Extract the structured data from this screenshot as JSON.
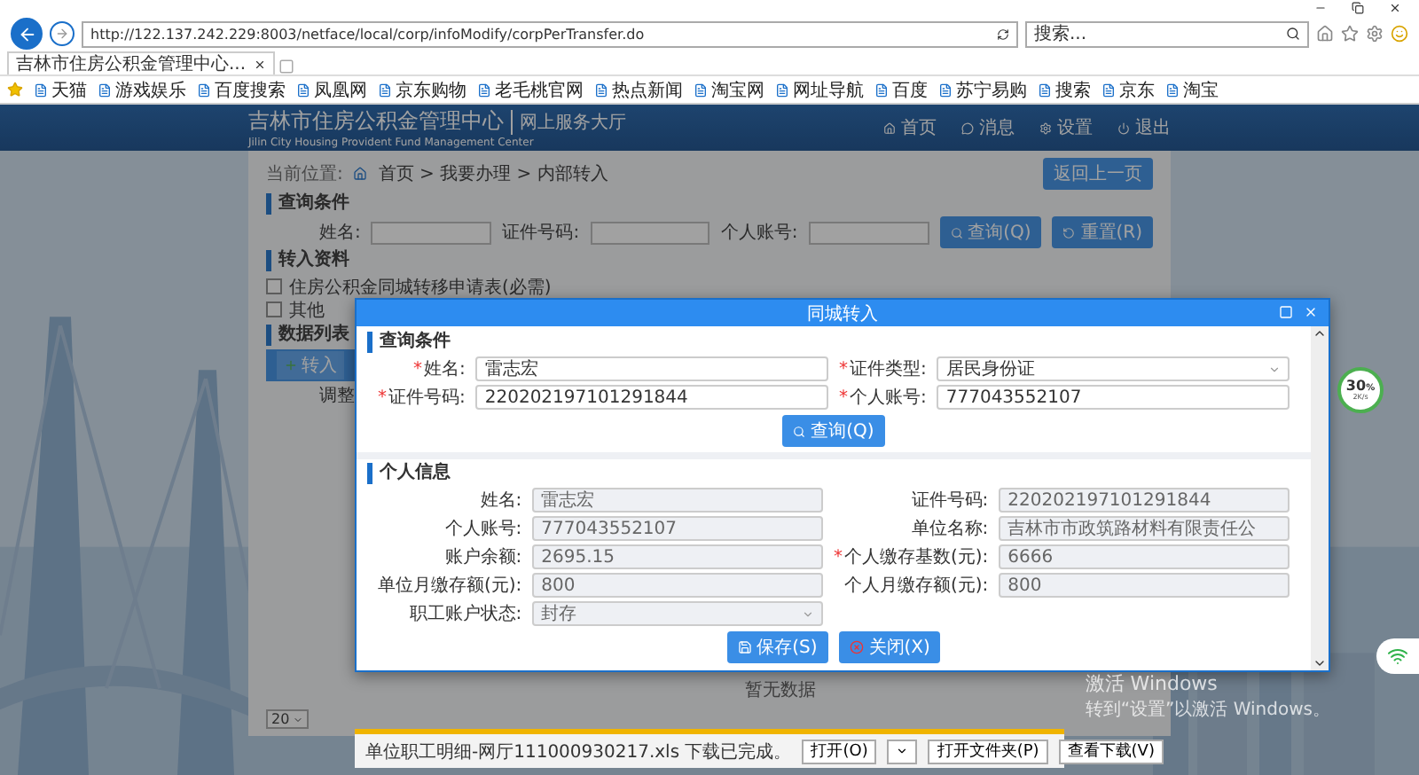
{
  "browser": {
    "url": "http://122.137.242.229:8003/netface/local/corp/infoModify/corpPerTransfer.do",
    "search_placeholder": "搜索...",
    "tab_title": "吉林市住房公积金管理中心...",
    "favorites": [
      "天猫",
      "游戏娱乐",
      "百度搜索",
      "凤凰网",
      "京东购物",
      "老毛桃官网",
      "热点新闻",
      "淘宝网",
      "网址导航",
      "百度",
      "苏宁易购",
      "搜索",
      "京东",
      "淘宝"
    ]
  },
  "header": {
    "title": "吉林市住房公积金管理中心",
    "subtitle": "网上服务大厅",
    "english": "Jilin City Housing Provident Fund Management Center",
    "nav": [
      {
        "label": "首页",
        "kind": "home"
      },
      {
        "label": "消息",
        "kind": "message"
      },
      {
        "label": "设置",
        "kind": "settings"
      },
      {
        "label": "退出",
        "kind": "logout"
      }
    ]
  },
  "breadcrumb": {
    "label": "当前位置:",
    "path": "首页 > 我要办理 > 内部转入"
  },
  "back_button": "返回上一页",
  "query": {
    "title": "查询条件",
    "fields": [
      "姓名:",
      "证件号码:",
      "个人账号:"
    ],
    "buttons": [
      {
        "label": "查询(Q)",
        "kind": "search"
      },
      {
        "label": "重置(R)",
        "kind": "reset"
      }
    ]
  },
  "materials": {
    "title": "转入资料",
    "items": [
      {
        "label": "住房公积金同城转移申请表(必需)",
        "checked": false
      },
      {
        "label": "其他",
        "checked": false
      }
    ]
  },
  "data_list": {
    "title": "数据列表",
    "add_button": "转入",
    "adjust_label": "调整",
    "empty_text": "暂无数据",
    "page_size": "20"
  },
  "modal": {
    "title": "同城转入",
    "query_title": "查询条件",
    "query_fields": [
      {
        "label": "姓名:",
        "value": "雷志宏",
        "marker": "*",
        "kind": "text"
      },
      {
        "label": "证件类型:",
        "value": "居民身份证",
        "marker": "*",
        "kind": "select"
      },
      {
        "label": "证件号码:",
        "value": "220202197101291844",
        "marker": "*",
        "kind": "text"
      },
      {
        "label": "个人账号:",
        "value": "777043552107",
        "marker": "*",
        "kind": "text"
      }
    ],
    "query_button": "查询(Q)",
    "info_title": "个人信息",
    "info_fields": [
      {
        "label": "姓名:",
        "value": "雷志宏",
        "kind": "text"
      },
      {
        "label": "证件号码:",
        "value": "220202197101291844",
        "kind": "text"
      },
      {
        "label": "个人账号:",
        "value": "777043552107",
        "kind": "text"
      },
      {
        "label": "单位名称:",
        "value": "吉林市市政筑路材料有限责任公",
        "kind": "text"
      },
      {
        "label": "账户余额:",
        "value": "2695.15",
        "kind": "text"
      },
      {
        "label": "个人缴存基数(元):",
        "value": "6666",
        "marker": "*",
        "kind": "text"
      },
      {
        "label": "单位月缴存额(元):",
        "value": "800",
        "kind": "text"
      },
      {
        "label": "个人月缴存额(元):",
        "value": "800",
        "kind": "text"
      },
      {
        "label": "职工账户状态:",
        "value": "封存",
        "kind": "select"
      }
    ],
    "buttons": [
      {
        "label": "保存(S)",
        "kind": "save"
      },
      {
        "label": "关闭(X)",
        "kind": "close"
      }
    ]
  },
  "download_bar": {
    "message": "单位职工明细-网厅111000930217.xls 下载已完成。",
    "buttons": [
      {
        "label": "打开(O)",
        "kind": "split"
      },
      {
        "label": "打开文件夹(P)",
        "kind": "plain"
      },
      {
        "label": "查看下载(V)",
        "kind": "plain"
      }
    ]
  },
  "speed_widget": {
    "percent": "30",
    "unit": "%",
    "speed": "2K/s"
  },
  "os_notice": {
    "title": "激活 Windows",
    "subtitle": "转到“设置”以激活 Windows。"
  }
}
